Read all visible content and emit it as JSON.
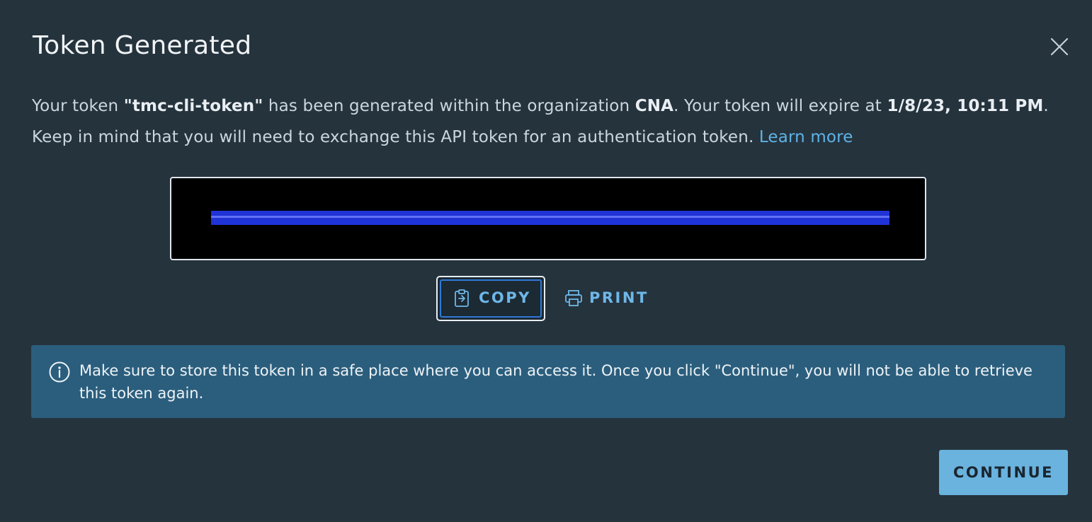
{
  "dialog": {
    "title": "Token Generated",
    "close_icon": "close-icon"
  },
  "message": {
    "line1_prefix": "Your token ",
    "token_name": "\"tmc-cli-token\"",
    "line1_mid": " has been generated within the organization ",
    "organization": "CNA",
    "line1_mid2": ". Your token will expire at ",
    "expiry": "1/8/23, 10:11 PM",
    "line1_suffix": ".",
    "line2": "Keep in mind that you will need to exchange this API token for an authentication token. ",
    "learn_more": "Learn more"
  },
  "token": {
    "value": "",
    "redacted": true
  },
  "actions": {
    "copy_label": "COPY",
    "copy_icon": "clipboard-icon",
    "print_label": "PRINT",
    "print_icon": "printer-icon"
  },
  "info": {
    "icon": "info-icon",
    "text": "Make sure to store this token in a safe place where you can access it. Once you click \"Continue\", you will not be able to retrieve this token again."
  },
  "footer": {
    "continue_label": "CONTINUE"
  },
  "colors": {
    "background": "#25333d",
    "accent": "#69b3de",
    "link": "#5fb3e6",
    "info_banner": "#2b5e7d",
    "focus_ring": "#3178d6"
  }
}
